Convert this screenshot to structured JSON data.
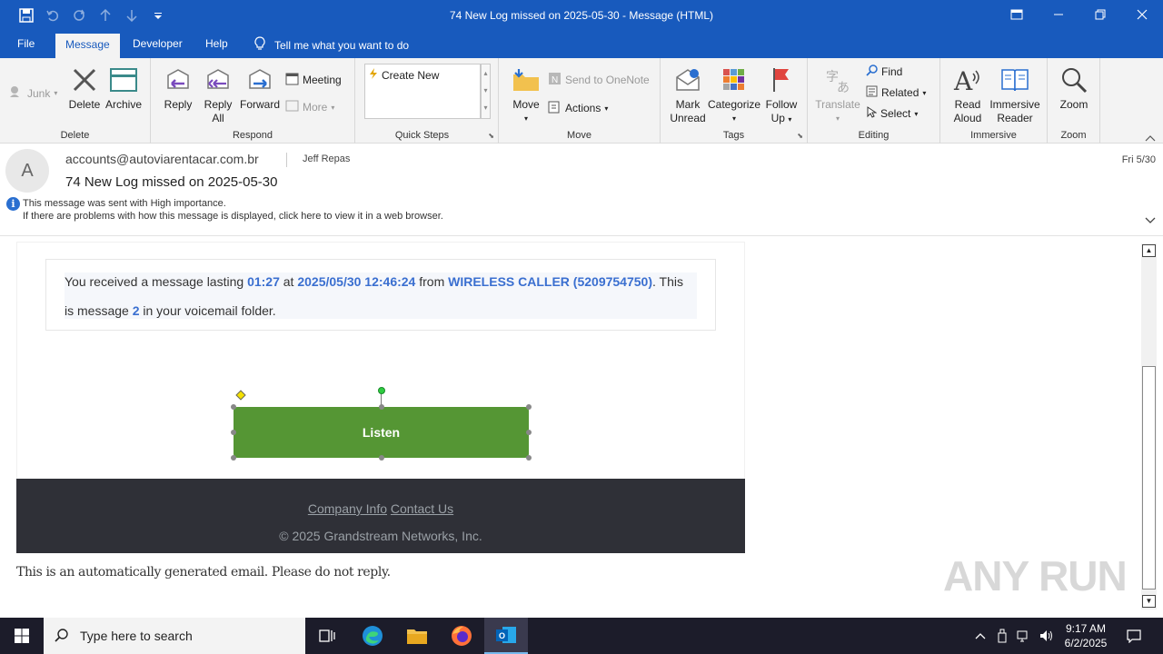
{
  "window": {
    "title": "74 New Log missed on 2025-05-30  -  Message (HTML)"
  },
  "tabs": [
    "File",
    "Message",
    "Developer",
    "Help"
  ],
  "tell_me": "Tell me what you want to do",
  "ribbon": {
    "junk": "Junk",
    "delete": "Delete",
    "archive": "Archive",
    "group_delete": "Delete",
    "reply": "Reply",
    "reply_all_1": "Reply",
    "reply_all_2": "All",
    "forward": "Forward",
    "meeting": "Meeting",
    "more": "More",
    "group_respond": "Respond",
    "create_new": "Create New",
    "group_quick_steps": "Quick Steps",
    "move": "Move",
    "send_onenote": "Send to OneNote",
    "actions": "Actions",
    "group_move": "Move",
    "mark_unread_1": "Mark",
    "mark_unread_2": "Unread",
    "categorize": "Categorize",
    "follow_up_1": "Follow",
    "follow_up_2": "Up",
    "group_tags": "Tags",
    "translate": "Translate",
    "find": "Find",
    "related": "Related",
    "select": "Select",
    "group_editing": "Editing",
    "read_aloud_1": "Read",
    "read_aloud_2": "Aloud",
    "immersive_1": "Immersive",
    "immersive_2": "Reader",
    "group_immersive": "Immersive",
    "zoom": "Zoom",
    "group_zoom": "Zoom"
  },
  "message": {
    "avatar_letter": "A",
    "from": "accounts@autoviarentacar.com.br",
    "to": "Jeff Repas",
    "subject": "74 New Log missed on 2025-05-30",
    "date": "Fri 5/30",
    "importance": "This message was sent with High importance.",
    "display_note": "If there are problems with how this message is displayed, click here to view it in a web browser."
  },
  "body": {
    "t1": "You received a message lasting ",
    "duration": "01:27",
    "t2": " at ",
    "datetime": "2025/05/30 12:46:24",
    "t3": " from ",
    "caller": "WIRELESS CALLER (5209754750)",
    "t4": ". This",
    "t5": "is message ",
    "msg_num": "2",
    "t6": " in your voicemail folder.",
    "listen": "Listen",
    "company_info": "Company Info",
    "contact_us": "Contact Us",
    "copyright": "© 2025 Grandstream Networks, Inc.",
    "auto_note": "This is an automatically generated email. Please do not reply."
  },
  "taskbar": {
    "search_placeholder": "Type here to search",
    "time": "9:17 AM",
    "date": "6/2/2025"
  },
  "watermark": "ANY RUN"
}
